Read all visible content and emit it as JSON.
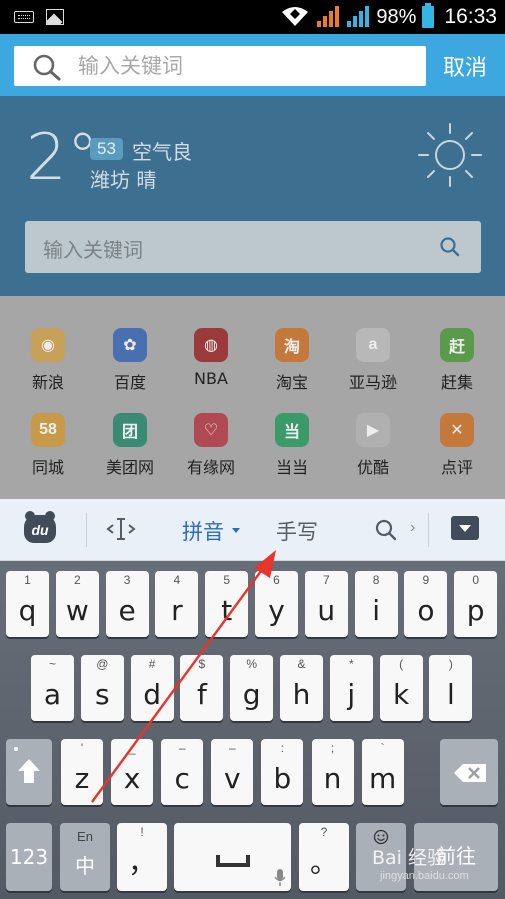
{
  "status_bar": {
    "battery": "98%",
    "time": "16:33"
  },
  "header": {
    "search_placeholder": "输入关键词",
    "cancel": "取消"
  },
  "weather": {
    "temperature": "2°",
    "aqi_value": "53",
    "aqi_label": "空气良",
    "city_weather": "潍坊  晴"
  },
  "page_search": {
    "placeholder": "输入关键词"
  },
  "apps": [
    {
      "label": "新浪",
      "color": "#c7a05a",
      "glyph": "◉"
    },
    {
      "label": "百度",
      "color": "#4a6fb0",
      "glyph": "✿"
    },
    {
      "label": "NBA",
      "color": "#9a3a3a",
      "glyph": "◍"
    },
    {
      "label": "淘宝",
      "color": "#c4793a",
      "glyph": "淘"
    },
    {
      "label": "亚马逊",
      "color": "#b8b8b8",
      "glyph": "a"
    },
    {
      "label": "赶集",
      "color": "#5a9a4a",
      "glyph": "赶"
    },
    {
      "label": "同城",
      "color": "#c79a4a",
      "glyph": "58"
    },
    {
      "label": "美团网",
      "color": "#3a8a74",
      "glyph": "团"
    },
    {
      "label": "有缘网",
      "color": "#b04a52",
      "glyph": "♡"
    },
    {
      "label": "当当",
      "color": "#3a9a6a",
      "glyph": "当"
    },
    {
      "label": "优酷",
      "color": "#b0b0b0",
      "glyph": "▶"
    },
    {
      "label": "点评",
      "color": "#c4793a",
      "glyph": "✕"
    }
  ],
  "ime_bar": {
    "logo": "du",
    "pinyin": "拼音",
    "handwriting": "手写",
    "more": "›"
  },
  "keys": {
    "row1": [
      {
        "hint": "1",
        "main": "q"
      },
      {
        "hint": "2",
        "main": "w"
      },
      {
        "hint": "3",
        "main": "e"
      },
      {
        "hint": "4",
        "main": "r"
      },
      {
        "hint": "5",
        "main": "t"
      },
      {
        "hint": "6",
        "main": "y"
      },
      {
        "hint": "7",
        "main": "u"
      },
      {
        "hint": "8",
        "main": "i"
      },
      {
        "hint": "9",
        "main": "o"
      },
      {
        "hint": "0",
        "main": "p"
      }
    ],
    "row2": [
      {
        "hint": "~",
        "main": "a"
      },
      {
        "hint": "@",
        "main": "s"
      },
      {
        "hint": "#",
        "main": "d"
      },
      {
        "hint": "$",
        "main": "f"
      },
      {
        "hint": "%",
        "main": "g"
      },
      {
        "hint": "&",
        "main": "h"
      },
      {
        "hint": "*",
        "main": "j"
      },
      {
        "hint": "(",
        "main": "k"
      },
      {
        "hint": ")",
        "main": "l"
      }
    ],
    "row3": [
      {
        "hint": "'",
        "main": "z"
      },
      {
        "hint": "_",
        "main": "x"
      },
      {
        "hint": "–",
        "main": "c"
      },
      {
        "hint": "–",
        "main": "v"
      },
      {
        "hint": ":",
        "main": "b"
      },
      {
        "hint": ";",
        "main": "n"
      },
      {
        "hint": "`",
        "main": "m"
      }
    ],
    "bottom": {
      "num": "123",
      "lang_hint": "En",
      "lang": "中",
      "comma_hint": "!",
      "comma": "，",
      "period_hint": "?",
      "period": "。",
      "enter": "前往"
    }
  },
  "watermark": {
    "line1": "Bai 经验",
    "line2": "jingyan.baidu.com"
  }
}
